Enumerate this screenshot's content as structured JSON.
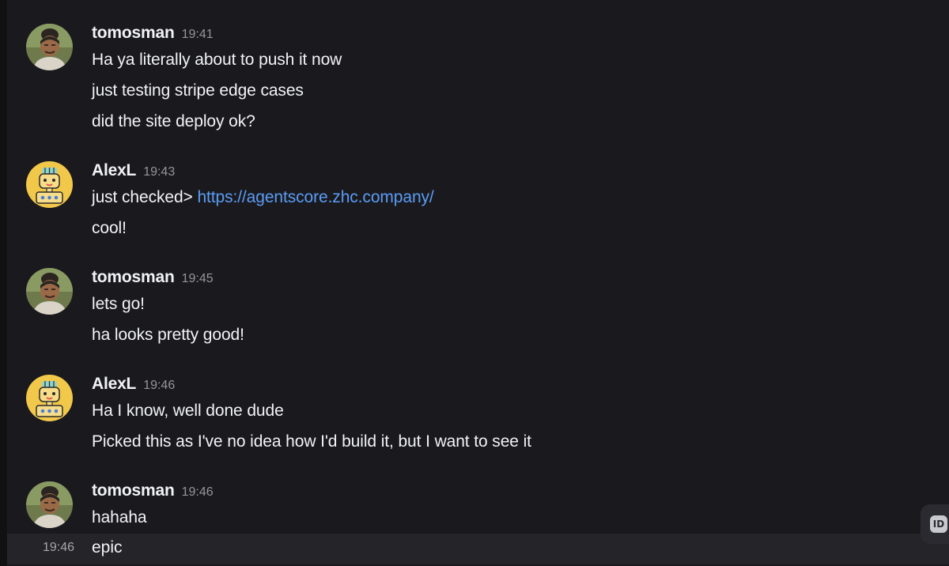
{
  "messages": [
    {
      "username": "tomosman",
      "time": "19:41",
      "avatar": "person-photo-avatar",
      "lines": [
        "Ha ya literally about to push it now",
        "just testing stripe edge cases",
        "did the site deploy ok?"
      ]
    },
    {
      "username": "AlexL",
      "time": "19:43",
      "avatar": "robot-avatar",
      "line0_prefix": "just checked> ",
      "line0_link": "https://agentscore.zhc.company/",
      "lines": [
        "cool!"
      ]
    },
    {
      "username": "tomosman",
      "time": "19:45",
      "avatar": "person-photo-avatar",
      "lines": [
        "lets go!",
        "ha looks pretty good!"
      ]
    },
    {
      "username": "AlexL",
      "time": "19:46",
      "avatar": "robot-avatar",
      "lines": [
        "Ha I know, well done dude",
        "Picked this as I've no idea how I'd build it, but I want to see it"
      ]
    },
    {
      "username": "tomosman",
      "time": "19:46",
      "avatar": "person-photo-avatar",
      "lines": [
        "hahaha"
      ]
    }
  ],
  "hovered_message": {
    "time": "19:46",
    "text": "epic"
  },
  "side_badge": {
    "icon": "id-icon",
    "label": "ID"
  },
  "colors": {
    "background": "#1a1a1e",
    "link": "#5b9cf5",
    "timestamp": "#94959c",
    "hover_row": "#242429"
  }
}
